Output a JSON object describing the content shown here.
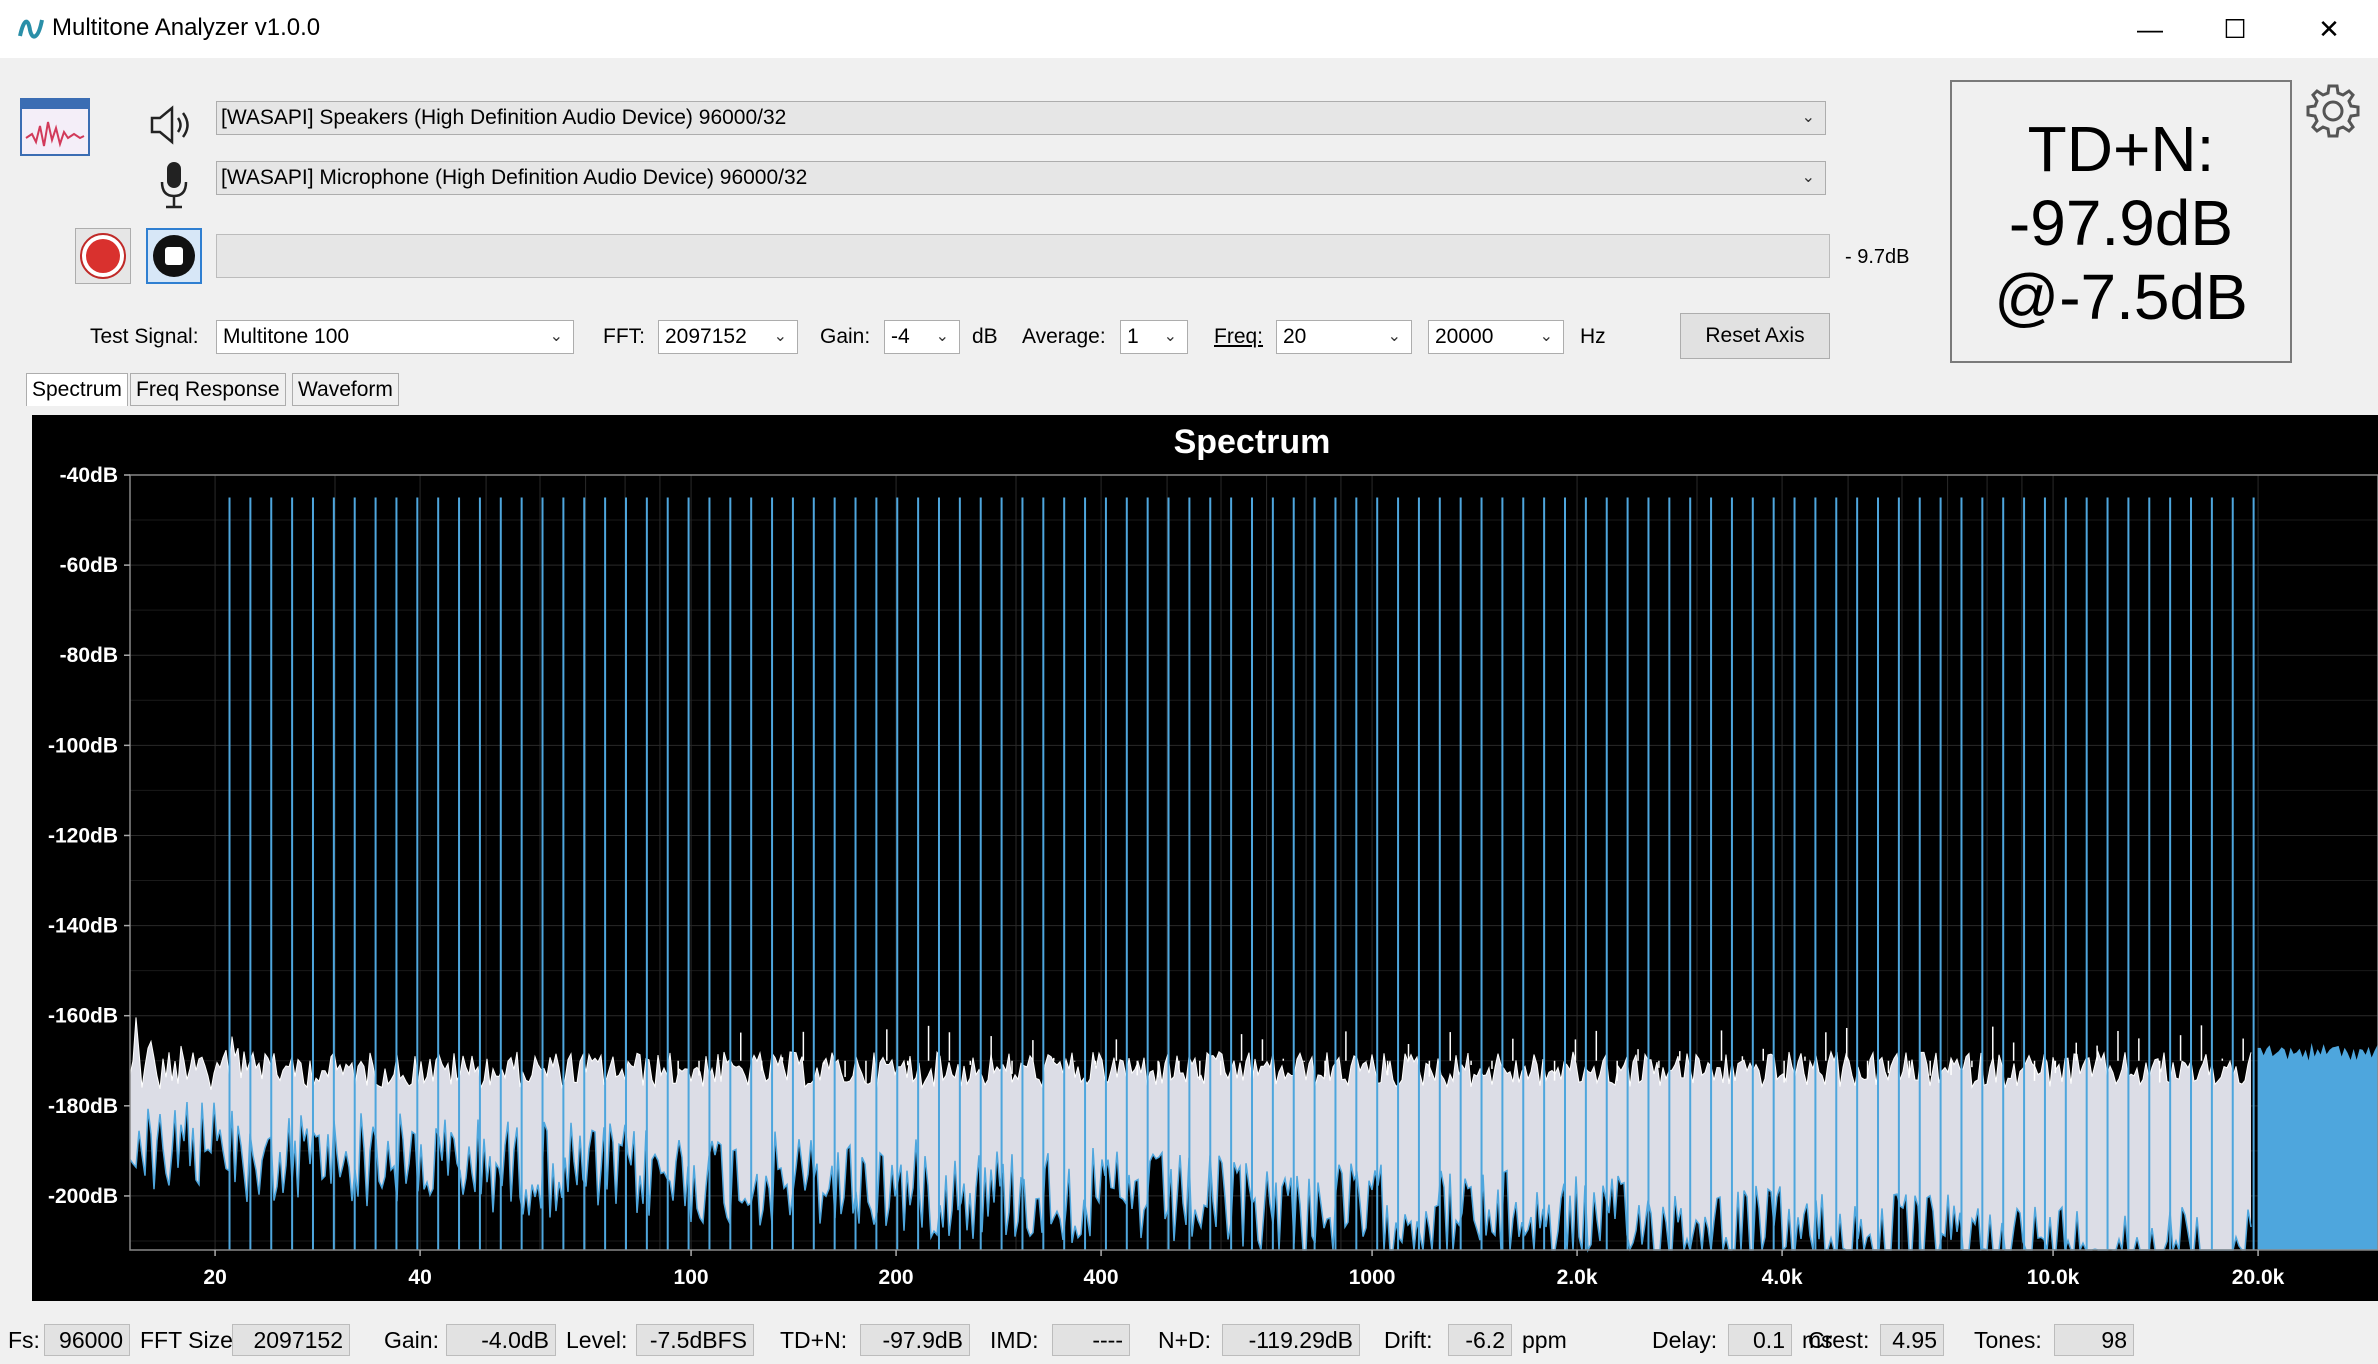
{
  "window": {
    "title": "Multitone Analyzer v1.0.0",
    "minimize_glyph": "—",
    "maximize_glyph": "☐",
    "close_glyph": "✕"
  },
  "devices": {
    "output": "[WASAPI] Speakers (High Definition Audio Device) 96000/32",
    "input": "[WASAPI] Microphone (High Definition Audio Device) 96000/32",
    "level_readout": "- 9.7dB",
    "level_fraction": 0
  },
  "controls": {
    "test_signal_label": "Test Signal:",
    "test_signal": "Multitone 100",
    "fft_label": "FFT:",
    "fft": "2097152",
    "gain_label": "Gain:",
    "gain": "-4",
    "gain_unit": "dB",
    "average_label": "Average:",
    "average": "1",
    "freq_label": "Freq:",
    "freq_min": "20",
    "freq_max": "20000",
    "freq_unit": "Hz",
    "reset_axis": "Reset Axis"
  },
  "tdn_display": {
    "line1": "TD+N:",
    "line2": "-97.9dB",
    "line3": "@-7.5dB"
  },
  "tabs": [
    "Spectrum",
    "Freq Response",
    "Waveform"
  ],
  "icons": {
    "app": "waveform-app-icon",
    "speaker": "speaker-icon",
    "microphone": "microphone-icon",
    "record": "record-icon",
    "stop": "stop-icon",
    "settings": "gear-icon"
  },
  "colors": {
    "spectrum": "#4ea6dd",
    "noise_fill": "#dcdde6",
    "plot_bg": "#000000",
    "grid": "#2a2a2a",
    "record_red": "#d9312e"
  },
  "chart_data": {
    "type": "line",
    "title": "Spectrum",
    "x_scale": "log",
    "xlim": [
      15,
      30000
    ],
    "ylim": [
      -212,
      -40
    ],
    "x_tick_values": [
      20,
      40,
      100,
      200,
      400,
      1000,
      2000,
      4000,
      10000,
      20000
    ],
    "x_tick_labels": [
      "20",
      "40",
      "100",
      "200",
      "400",
      "1000",
      "2.0k",
      "4.0k",
      "10.0k",
      "20.0k"
    ],
    "y_tick_values": [
      -40,
      -60,
      -80,
      -100,
      -120,
      -140,
      -160,
      -180,
      -200
    ],
    "y_tick_labels": [
      "-40dB",
      "-60dB",
      "-80dB",
      "-100dB",
      "-120dB",
      "-140dB",
      "-160dB",
      "-180dB",
      "-200dB"
    ],
    "grid": true,
    "tone_count": 98,
    "tone_freq_range": [
      21,
      19700
    ],
    "tone_level_db": -45,
    "distortion_peak_db_range": [
      -175,
      -162
    ],
    "noise_floor_db_range": [
      -212,
      -165
    ]
  },
  "status": [
    {
      "label": "Fs:",
      "value": "96000"
    },
    {
      "label": "FFT Size:",
      "value": "2097152"
    },
    {
      "label": "Gain:",
      "value": "-4.0dB"
    },
    {
      "label": "Level:",
      "value": "-7.5dBFS"
    },
    {
      "label": "TD+N:",
      "value": "-97.9dB"
    },
    {
      "label": "IMD:",
      "value": "----"
    },
    {
      "label": "N+D:",
      "value": "-119.29dB"
    },
    {
      "label": "Drift:",
      "value": "-6.2",
      "unit": "ppm"
    },
    {
      "label": "Delay:",
      "value": "0.1",
      "unit": "ms"
    },
    {
      "label": "Crest:",
      "value": "4.95"
    },
    {
      "label": "Tones:",
      "value": "98"
    }
  ]
}
